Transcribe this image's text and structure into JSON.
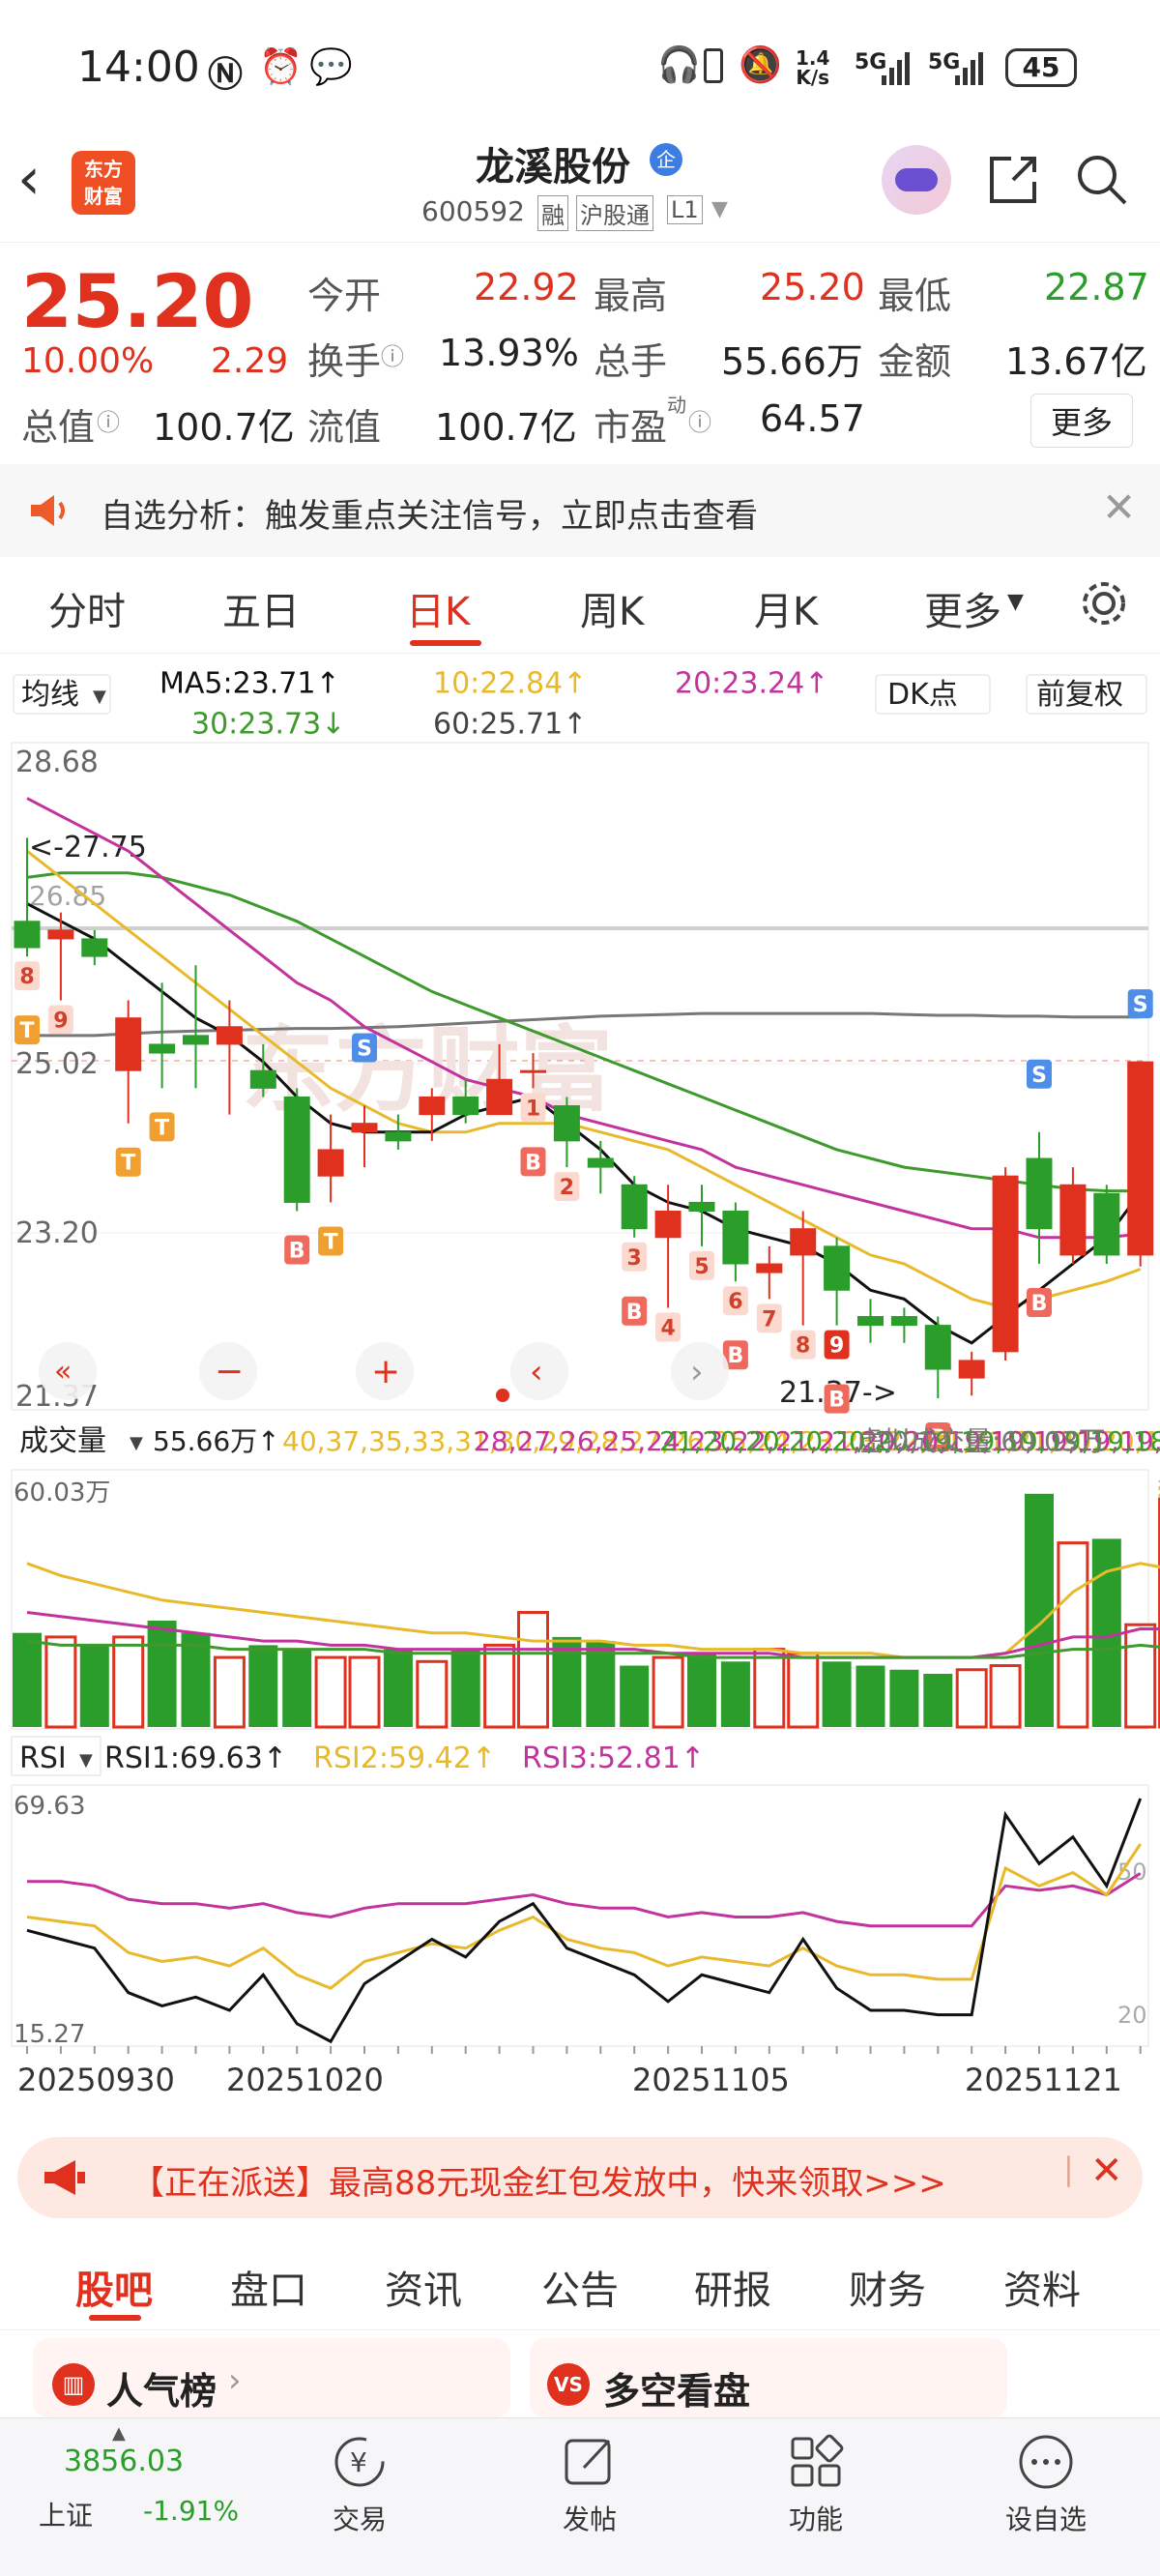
{
  "status": {
    "time": "14:00",
    "net_speed_top": "1.4",
    "net_speed_bottom": "K/s",
    "sig1": "5G",
    "sig2": "5G",
    "battery": "45"
  },
  "header": {
    "title": "龙溪股份",
    "badge": "企",
    "code": "600592",
    "tags": [
      "融",
      "沪股通",
      "L1"
    ],
    "brand_line1": "东方",
    "brand_line2": "财富"
  },
  "quote": {
    "price": "25.20",
    "change_pct": "10.00%",
    "change_amt": "2.29",
    "rows": [
      [
        {
          "l": "今开",
          "v": "22.92",
          "c": "red"
        },
        {
          "l": "最高",
          "v": "25.20",
          "c": "red"
        },
        {
          "l": "最低",
          "v": "22.87",
          "c": "green"
        }
      ],
      [
        {
          "l": "换手",
          "v": "13.93%",
          "c": "dark"
        },
        {
          "l": "总手",
          "v": "55.66万",
          "c": "dark"
        },
        {
          "l": "金额",
          "v": "13.67亿",
          "c": "dark"
        }
      ]
    ],
    "row3": {
      "l1": "总值",
      "v1": "100.7亿",
      "l2": "流值",
      "v2": "100.7亿",
      "l3": "市盈",
      "sup3": "动",
      "v3": "64.57"
    },
    "more": "更多"
  },
  "notice": {
    "text": "自选分析：触发重点关注信号，立即点击查看"
  },
  "tabs": [
    "分时",
    "五日",
    "日K",
    "周K",
    "月K",
    "更多"
  ],
  "active_tab": "日K",
  "ma_bar": {
    "selector": "均线",
    "ma5": "MA5:23.71↑",
    "ma10": "10:22.84↑",
    "ma20": "20:23.24↑",
    "ma30": "30:23.73↓",
    "ma60": "60:25.71↑",
    "dk": "DK点",
    "adjust": "前复权"
  },
  "kline": {
    "ylabels": [
      "28.68",
      "25.02",
      "23.20",
      "21.37"
    ],
    "high_note": "<-27.75",
    "low_note": "21.37->",
    "ref_label": "26.85",
    "dates": [
      "20250930",
      "20251020",
      "20251105",
      "20251121"
    ],
    "candles": [
      {
        "o": 26.8,
        "c": 26.5,
        "h": 27.75,
        "l": 26.4
      },
      {
        "o": 26.6,
        "c": 26.7,
        "h": 26.9,
        "l": 25.9
      },
      {
        "o": 26.6,
        "c": 26.4,
        "h": 26.7,
        "l": 26.3
      },
      {
        "o": 25.1,
        "c": 25.7,
        "h": 25.9,
        "l": 24.5
      },
      {
        "o": 25.4,
        "c": 25.3,
        "h": 26.1,
        "l": 24.9
      },
      {
        "o": 25.5,
        "c": 25.4,
        "h": 26.3,
        "l": 24.9
      },
      {
        "o": 25.4,
        "c": 25.6,
        "h": 25.9,
        "l": 24.6
      },
      {
        "o": 25.1,
        "c": 24.9,
        "h": 25.4,
        "l": 24.8
      },
      {
        "o": 24.8,
        "c": 23.6,
        "h": 24.9,
        "l": 23.5
      },
      {
        "o": 23.9,
        "c": 24.2,
        "h": 24.6,
        "l": 23.6
      },
      {
        "o": 24.4,
        "c": 24.5,
        "h": 24.7,
        "l": 24.0
      },
      {
        "o": 24.4,
        "c": 24.3,
        "h": 24.6,
        "l": 24.2
      },
      {
        "o": 24.6,
        "c": 24.8,
        "h": 24.9,
        "l": 24.3
      },
      {
        "o": 24.8,
        "c": 24.6,
        "h": 25.0,
        "l": 24.5
      },
      {
        "o": 24.6,
        "c": 25.0,
        "h": 25.4,
        "l": 24.6
      },
      {
        "o": 25.1,
        "c": 25.1,
        "h": 25.3,
        "l": 24.9
      },
      {
        "o": 24.7,
        "c": 24.3,
        "h": 24.8,
        "l": 24.0
      },
      {
        "o": 24.1,
        "c": 24.0,
        "h": 24.3,
        "l": 23.7
      },
      {
        "o": 23.8,
        "c": 23.3,
        "h": 23.9,
        "l": 23.2
      },
      {
        "o": 23.2,
        "c": 23.5,
        "h": 23.8,
        "l": 22.4
      },
      {
        "o": 23.6,
        "c": 23.5,
        "h": 23.8,
        "l": 23.1
      },
      {
        "o": 23.5,
        "c": 22.9,
        "h": 23.6,
        "l": 22.7
      },
      {
        "o": 22.8,
        "c": 22.9,
        "h": 23.1,
        "l": 22.5
      },
      {
        "o": 23.0,
        "c": 23.3,
        "h": 23.5,
        "l": 22.2
      },
      {
        "o": 23.1,
        "c": 22.6,
        "h": 23.2,
        "l": 22.2
      },
      {
        "o": 22.3,
        "c": 22.2,
        "h": 22.5,
        "l": 22.0
      },
      {
        "o": 22.3,
        "c": 22.2,
        "h": 22.4,
        "l": 22.0
      },
      {
        "o": 22.2,
        "c": 21.7,
        "h": 22.3,
        "l": 21.37
      },
      {
        "o": 21.6,
        "c": 21.8,
        "h": 21.9,
        "l": 21.4
      },
      {
        "o": 21.9,
        "c": 23.9,
        "h": 24.0,
        "l": 21.8
      },
      {
        "o": 24.1,
        "c": 23.3,
        "h": 24.4,
        "l": 22.9
      },
      {
        "o": 23.0,
        "c": 23.8,
        "h": 24.0,
        "l": 22.9
      },
      {
        "o": 23.7,
        "c": 23.0,
        "h": 23.8,
        "l": 22.9
      },
      {
        "o": 23.0,
        "c": 25.2,
        "h": 25.2,
        "l": 22.87
      }
    ],
    "ma5": [
      27.0,
      26.8,
      26.6,
      26.3,
      26.0,
      25.7,
      25.5,
      25.2,
      24.8,
      24.5,
      24.4,
      24.4,
      24.4,
      24.6,
      24.7,
      24.8,
      24.5,
      24.2,
      23.8,
      23.6,
      23.5,
      23.3,
      23.2,
      23.1,
      22.9,
      22.6,
      22.5,
      22.2,
      22.0,
      22.3,
      22.6,
      22.9,
      23.2,
      23.71
    ],
    "ma10": [
      27.6,
      27.3,
      27.0,
      26.7,
      26.4,
      26.1,
      25.8,
      25.5,
      25.2,
      24.9,
      24.7,
      24.5,
      24.4,
      24.4,
      24.5,
      24.5,
      24.5,
      24.4,
      24.3,
      24.2,
      24.0,
      23.8,
      23.6,
      23.4,
      23.2,
      23.0,
      22.9,
      22.7,
      22.5,
      22.4,
      22.5,
      22.6,
      22.7,
      22.84
    ],
    "ma20": [
      28.2,
      28.0,
      27.8,
      27.6,
      27.3,
      27.0,
      26.7,
      26.4,
      26.1,
      25.9,
      25.6,
      25.4,
      25.2,
      25.0,
      24.9,
      24.8,
      24.6,
      24.5,
      24.4,
      24.3,
      24.2,
      24.0,
      23.9,
      23.8,
      23.7,
      23.6,
      23.5,
      23.4,
      23.3,
      23.3,
      23.2,
      23.2,
      23.2,
      23.24
    ],
    "ma30": [
      27.3,
      27.35,
      27.35,
      27.35,
      27.3,
      27.2,
      27.1,
      26.95,
      26.8,
      26.6,
      26.4,
      26.2,
      26.0,
      25.85,
      25.7,
      25.55,
      25.4,
      25.25,
      25.1,
      24.95,
      24.8,
      24.65,
      24.5,
      24.35,
      24.2,
      24.1,
      24.0,
      23.95,
      23.9,
      23.85,
      23.8,
      23.75,
      23.73,
      23.73
    ],
    "ma60": [
      25.5,
      25.5,
      25.5,
      25.52,
      25.54,
      25.55,
      25.56,
      25.57,
      25.58,
      25.58,
      25.59,
      25.6,
      25.62,
      25.64,
      25.66,
      25.68,
      25.7,
      25.72,
      25.73,
      25.74,
      25.75,
      25.75,
      25.75,
      25.75,
      25.75,
      25.75,
      25.74,
      25.73,
      25.73,
      25.72,
      25.72,
      25.71,
      25.71,
      25.71
    ],
    "signals": [
      {
        "i": 0,
        "t": "8",
        "k": "B"
      },
      {
        "i": 0,
        "t": "T",
        "k": "T"
      },
      {
        "i": 1,
        "t": "9",
        "k": "B"
      },
      {
        "i": 3,
        "t": "T",
        "k": "T"
      },
      {
        "i": 4,
        "t": "T",
        "k": "T"
      },
      {
        "i": 8,
        "t": "B",
        "k": "Bred"
      },
      {
        "i": 9,
        "t": "T",
        "k": "T"
      },
      {
        "i": 10,
        "t": "S",
        "k": "S"
      },
      {
        "i": 15,
        "t": "1",
        "k": "B"
      },
      {
        "i": 15,
        "t": "B",
        "k": "Bred"
      },
      {
        "i": 16,
        "t": "2",
        "k": "B"
      },
      {
        "i": 18,
        "t": "3",
        "k": "B"
      },
      {
        "i": 18,
        "t": "B",
        "k": "Bred"
      },
      {
        "i": 19,
        "t": "4",
        "k": "B"
      },
      {
        "i": 20,
        "t": "5",
        "k": "B"
      },
      {
        "i": 21,
        "t": "6",
        "k": "B"
      },
      {
        "i": 21,
        "t": "B",
        "k": "Bred"
      },
      {
        "i": 22,
        "t": "7",
        "k": "B"
      },
      {
        "i": 23,
        "t": "8",
        "k": "B"
      },
      {
        "i": 24,
        "t": "9",
        "k": "Bred2"
      },
      {
        "i": 24,
        "t": "B",
        "k": "Bred"
      },
      {
        "i": 27,
        "t": "B",
        "k": "Bred"
      },
      {
        "i": 30,
        "t": "S",
        "k": "S"
      },
      {
        "i": 30,
        "t": "B",
        "k": "Bred"
      },
      {
        "i": 33,
        "t": "S",
        "k": "S"
      }
    ]
  },
  "volume": {
    "label": "成交量",
    "vol": "55.66万↑",
    "ma1": [
      40,
      37,
      35,
      33,
      31,
      30,
      29,
      28,
      27,
      26,
      25,
      24,
      23,
      23,
      22,
      21,
      21,
      21,
      20,
      20,
      19,
      19,
      19,
      18,
      18,
      18,
      17,
      17,
      17,
      18,
      25,
      33,
      38,
      40,
      38.46
    ],
    "ma2": [
      28,
      27,
      26,
      25,
      24,
      23,
      22,
      21,
      21,
      20,
      20,
      19,
      19,
      19,
      19,
      19,
      19,
      19,
      19,
      18,
      18,
      18,
      18,
      17,
      17,
      17,
      17,
      17,
      17,
      18,
      20,
      22,
      22,
      24,
      23.94
    ],
    "ma3": [
      21,
      20,
      20,
      20,
      20,
      20,
      19,
      19,
      19,
      19,
      19,
      18,
      18,
      18,
      18,
      18,
      18,
      18,
      18,
      18,
      17,
      17,
      17,
      17,
      17,
      17,
      17,
      17,
      17,
      17,
      18,
      19,
      19,
      20,
      19.21
    ],
    "virtual": "虚拟成交量:60.03万",
    "ymax_label": "60.03万",
    "bars": [
      23,
      22,
      20,
      22,
      26,
      23,
      17,
      20,
      19,
      17,
      17,
      19,
      16,
      19,
      20,
      28,
      22,
      21,
      15,
      17,
      18,
      16,
      19,
      18,
      16,
      15,
      14,
      13,
      14,
      15,
      57,
      45,
      46,
      25,
      55.66
    ],
    "virtual_last": 60.03
  },
  "rsi": {
    "selector": "RSI",
    "rsi1": "RSI1:69.63↑",
    "rsi2": "RSI2:59.42↑",
    "rsi3": "RSI3:52.81↑",
    "ymax_label": "69.63",
    "ymin_label": "15.27",
    "ref50": "50",
    "ref20": "20",
    "r1": [
      40,
      38,
      36,
      26,
      23,
      25,
      22,
      30,
      19,
      15,
      28,
      33,
      38,
      34,
      42,
      46,
      36,
      33,
      30,
      24,
      30,
      28,
      26,
      38,
      27,
      22,
      22,
      21,
      21,
      66,
      55,
      61,
      50,
      69.63
    ],
    "r2": [
      43,
      42,
      41,
      35,
      33,
      34,
      32,
      36,
      30,
      27,
      33,
      35,
      37,
      36,
      40,
      43,
      38,
      36,
      35,
      32,
      34,
      33,
      32,
      36,
      32,
      30,
      30,
      29,
      29,
      54,
      50,
      53,
      48,
      59.42
    ],
    "r3": [
      51,
      51,
      50,
      47,
      46,
      46,
      45,
      46,
      44,
      43,
      45,
      46,
      46,
      46,
      47,
      48,
      46,
      45,
      45,
      43,
      44,
      43,
      43,
      44,
      42,
      41,
      41,
      41,
      41,
      50,
      49,
      50,
      48,
      52.81
    ]
  },
  "chart_data": [
    {
      "type": "candlestick",
      "title": "日K",
      "x": [
        "20250930",
        "20251020",
        "20251105",
        "20251121"
      ],
      "ylim": [
        21.37,
        28.68
      ],
      "series": [
        {
          "name": "MA5",
          "values": [
            23.71
          ]
        },
        {
          "name": "MA10",
          "values": [
            22.84
          ]
        },
        {
          "name": "MA20",
          "values": [
            23.24
          ]
        },
        {
          "name": "MA30",
          "values": [
            23.73
          ]
        },
        {
          "name": "MA60",
          "values": [
            25.71
          ]
        }
      ]
    },
    {
      "type": "bar",
      "title": "成交量",
      "ylim": [
        0,
        60.03
      ],
      "series": [
        {
          "name": "成交量",
          "values": [
            55.66
          ]
        },
        {
          "name": "MA1",
          "values": [
            38.46
          ]
        },
        {
          "name": "MA2",
          "values": [
            23.94
          ]
        },
        {
          "name": "MA3",
          "values": [
            19.21
          ]
        }
      ]
    },
    {
      "type": "line",
      "title": "RSI",
      "ylim": [
        15.27,
        69.63
      ],
      "series": [
        {
          "name": "RSI1",
          "values": [
            69.63
          ]
        },
        {
          "name": "RSI2",
          "values": [
            59.42
          ]
        },
        {
          "name": "RSI3",
          "values": [
            52.81
          ]
        }
      ]
    }
  ],
  "promo": {
    "text": "【正在派送】最高88元现金红包发放中，快来领取>>>"
  },
  "bottom_tabs": [
    "股吧",
    "盘口",
    "资讯",
    "公告",
    "研报",
    "财务",
    "资料"
  ],
  "cards": {
    "left": "人气榜",
    "right": "多空看盘"
  },
  "nav": {
    "index_value": "3856.03",
    "index_name": "上证",
    "index_change": "-1.91%",
    "items": [
      "交易",
      "发帖",
      "功能",
      "设自选"
    ]
  },
  "colors": {
    "up": "#e0301e",
    "down": "#2a9d2a",
    "ma5": "#111111",
    "ma10": "#e8b92b",
    "ma20": "#c2339e",
    "ma30": "#3e9a2c",
    "ma60": "#777777"
  }
}
